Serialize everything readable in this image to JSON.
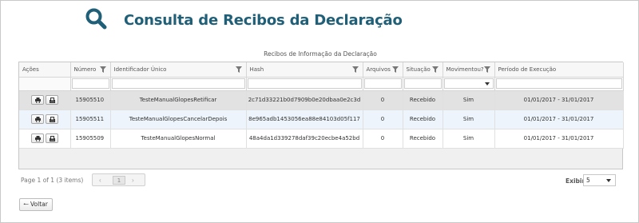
{
  "page": {
    "title": "Consulta de Recibos da Declaração"
  },
  "grid": {
    "caption": "Recibos de Informação da Declaração",
    "columns": [
      "Ações",
      "Número",
      "Identificador Único",
      "Hash",
      "Arquivos",
      "Situação",
      "Movimentou?",
      "Período de Execução"
    ],
    "rows": [
      {
        "numero": "15905510",
        "identificador": "TesteManualGlopesRetificar",
        "hash": "2c71d33221b0d7909b0e20dbaa0e2c3d",
        "arquivos": "0",
        "situacao": "Recebido",
        "movimentou": "Sim",
        "periodo": "01/01/2017 - 31/01/2017"
      },
      {
        "numero": "15905511",
        "identificador": "TesteManualGlopesCancelarDepois",
        "hash": "8e965adb1453056ea88e84103d05f117",
        "arquivos": "0",
        "situacao": "Recebido",
        "movimentou": "Sim",
        "periodo": "01/01/2017 - 31/01/2017"
      },
      {
        "numero": "15905509",
        "identificador": "TesteManualGlopesNormal",
        "hash": "48a4da1d339278daf39c20ecbe4a52bd",
        "arquivos": "0",
        "situacao": "Recebido",
        "movimentou": "Sim",
        "periodo": "01/01/2017 - 31/01/2017"
      }
    ],
    "selected_row_index": 0
  },
  "pager": {
    "info": "Page 1 of 1 (3 items)",
    "current_page": "1",
    "prev_symbol": "‹",
    "next_symbol": "›",
    "page_size_label": "Exibir",
    "page_size_value": "5"
  },
  "actions": {
    "back_label": "Voltar",
    "back_icon": "arrow-left-icon"
  },
  "icons": {
    "header": "search-icon",
    "print": "print-icon",
    "download": "download-icon",
    "filter": "filter-icon"
  },
  "colors": {
    "title": "#1f5f77",
    "selected_row": "#e2e2e2",
    "alt_row": "#edf4fb"
  }
}
